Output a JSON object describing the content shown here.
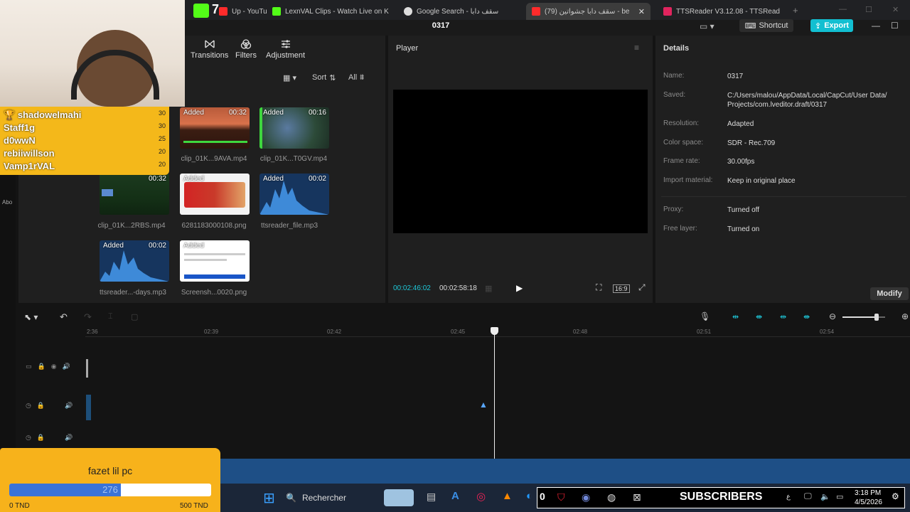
{
  "browser": {
    "tabs": [
      {
        "label": "Up - YouTu",
        "color": "#ff2b2b"
      },
      {
        "label": "LexnVAL Clips - Watch Live on K",
        "color": "#53fc18"
      },
      {
        "label": "Google Search - سقف دابا",
        "color": "#dddddd"
      },
      {
        "label": "(79) سقف دابا جشواتين - be",
        "color": "#ff2b2b",
        "active": true
      },
      {
        "label": "TTSReader V3.12.08 - TTSRead",
        "color": "#e0245e"
      }
    ],
    "kick_badge": "7"
  },
  "app": {
    "project_title": "0317",
    "shortcut_label": "Shortcut",
    "export_label": "Export",
    "accent_color": "#12bfd1"
  },
  "media": {
    "tools": [
      {
        "label": "Transitions",
        "icon": "transitions-icon"
      },
      {
        "label": "Filters",
        "icon": "filters-icon"
      },
      {
        "label": "Adjustment",
        "icon": "adjustment-icon"
      }
    ],
    "sort_label": "Sort",
    "filter_label": "All",
    "added_label": "Added",
    "items": [
      {
        "duration": "00:32",
        "name": "clip_01K...9AVA.mp4"
      },
      {
        "duration": "00:16",
        "name": "clip_01K...T0GV.mp4"
      },
      {
        "duration": "00:32",
        "name": "clip_01K...2RBS.mp4"
      },
      {
        "duration": "",
        "name": "6281183000108.png"
      },
      {
        "duration": "00:02",
        "name": "ttsreader_file.mp3"
      },
      {
        "duration": "00:02",
        "name": "ttsreader...-days.mp3"
      },
      {
        "duration": "",
        "name": "Screensh...0020.png"
      }
    ],
    "side_label": "Abo"
  },
  "player": {
    "title": "Player",
    "current_time": "00:02:46:02",
    "total_time": "00:02:58:18",
    "ratio_label": "16:9"
  },
  "details": {
    "title": "Details",
    "rows": [
      {
        "label": "Name:",
        "value": "0317"
      },
      {
        "label": "Saved:",
        "value": "C:/Users/malou/AppData/Local/CapCut/User Data/ Projects/com.lveditor.draft/0317"
      },
      {
        "label": "Resolution:",
        "value": "Adapted"
      },
      {
        "label": "Color space:",
        "value": "SDR - Rec.709"
      },
      {
        "label": "Frame rate:",
        "value": "30.00fps"
      },
      {
        "label": "Import material:",
        "value": "Keep in original place"
      },
      {
        "label": "Proxy:",
        "value": "Turned off"
      },
      {
        "label": "Free layer:",
        "value": "Turned on"
      }
    ],
    "modify_label": "Modify"
  },
  "timeline": {
    "ticks": [
      "2:36",
      "02:39",
      "02:42",
      "02:45",
      "02:48",
      "02:51",
      "02:54"
    ],
    "zoom_fraction": 0.8
  },
  "leaderboard": {
    "entries": [
      {
        "name": "shadowelmahi",
        "score": "30"
      },
      {
        "name": "Staff1g",
        "score": "30"
      },
      {
        "name": "d0wwN",
        "score": "25"
      },
      {
        "name": "rebiiwillson",
        "score": "20"
      },
      {
        "name": "Vamp1rVAL",
        "score": "20"
      }
    ],
    "color": "#f4b81a"
  },
  "goal": {
    "title": "fazet lil pc",
    "current": "276",
    "min_label": "0 TND",
    "max_label": "500 TND",
    "fraction": 0.552
  },
  "taskbar": {
    "search_label": "Rechercher",
    "subscribers_label": "SUBSCRIBERS",
    "subscribers_count": "0",
    "time": "3:18 PM",
    "date": "4/5/2026",
    "lang": "ع"
  }
}
